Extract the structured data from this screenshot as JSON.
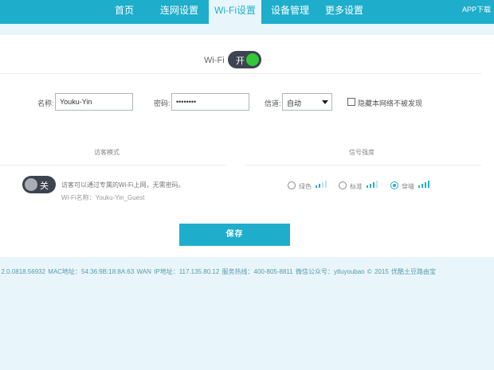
{
  "nav": {
    "items": [
      {
        "label": "首页"
      },
      {
        "label": "连网设置"
      },
      {
        "label": "Wi-Fi设置"
      },
      {
        "label": "设备管理"
      },
      {
        "label": "更多设置"
      }
    ],
    "active": "Wi-Fi设置",
    "app_download": "APP下载"
  },
  "wifi": {
    "label": "Wi-Fi",
    "toggle_text": "开",
    "enabled": true
  },
  "settings": {
    "name_label": "名称:",
    "name_value": "Youku-Yin",
    "password_label": "密码:",
    "password_value": "password",
    "channel_label": "信道:",
    "channel_value": "自动",
    "hide_label": "隐藏本网络不被发现",
    "hide_checked": false
  },
  "guest": {
    "section_title": "访客模式",
    "toggle_text": "关",
    "enabled": false,
    "note": "访客可以通过专属的Wi-Fi上网，无需密码。",
    "name_line": "Wi-Fi名称：Youku-Yin_Guest"
  },
  "signal": {
    "section_title": "信号强度",
    "options": [
      {
        "label": "绿色",
        "checked": false,
        "strength": 1
      },
      {
        "label": "标准",
        "checked": false,
        "strength": 2
      },
      {
        "label": "穿墙",
        "checked": true,
        "strength": 3
      }
    ],
    "bar_active_color": "#1eaecb",
    "bar_inactive_color": "#bfe3ee"
  },
  "save_label": "保存",
  "footer": {
    "text": ": 2.0.0818.56932    MAC地址：54:36:9B:18:8A:63    WAN IP地址：117.135.80.12    服务热线：400-805-8811    微信公众号：ytluyoubao    © 2015 优酷土豆路由宝"
  },
  "colors": {
    "accent": "#1eaecb",
    "toggle_dark": "#3d4450",
    "toggle_on_knob": "#35c63a",
    "background": "#e8f6fb"
  }
}
